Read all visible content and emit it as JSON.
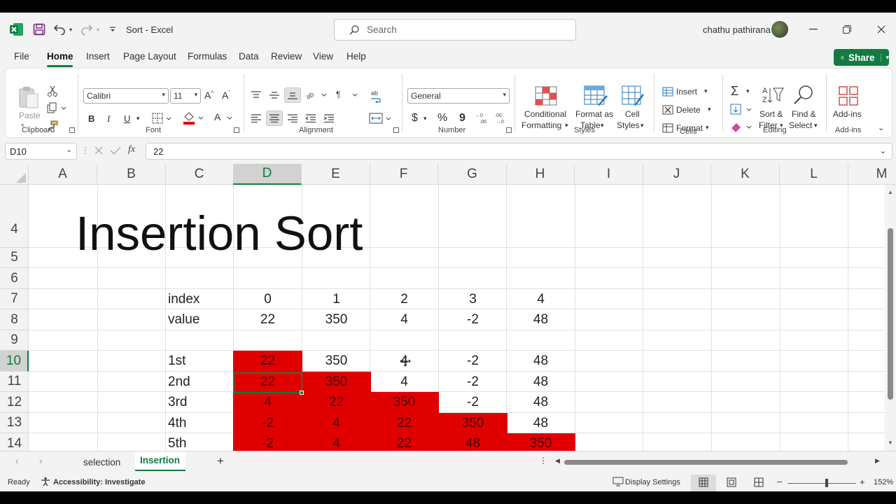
{
  "window": {
    "title": "Sort  -  Excel",
    "user_name": "chathu pathirana",
    "search_placeholder": "Search"
  },
  "menu": {
    "items": [
      "File",
      "Home",
      "Insert",
      "Page Layout",
      "Formulas",
      "Data",
      "Review",
      "View",
      "Help"
    ],
    "active": "Home",
    "share_label": "Share"
  },
  "ribbon": {
    "clipboard": {
      "paste": "Paste",
      "group": "Clipboard"
    },
    "font": {
      "family": "Calibri",
      "size": "11",
      "group": "Font",
      "bold": "B",
      "italic": "I",
      "underline": "U"
    },
    "alignment": {
      "group": "Alignment"
    },
    "number": {
      "format": "General",
      "group": "Number",
      "currency": "$",
      "percent": "%",
      "comma": "9"
    },
    "styles": {
      "conditional_1": "Conditional",
      "conditional_2": "Formatting",
      "format_table_1": "Format as",
      "format_table_2": "Table",
      "cell_styles_1": "Cell",
      "cell_styles_2": "Styles",
      "group": "Styles"
    },
    "cells": {
      "insert": "Insert",
      "delete": "Delete",
      "format": "Format",
      "group": "Cells"
    },
    "editing": {
      "sort_1": "Sort &",
      "sort_2": "Filter",
      "find_1": "Find &",
      "find_2": "Select",
      "group": "Editing"
    },
    "addins": {
      "label": "Add-ins",
      "group": "Add-ins"
    }
  },
  "formula_bar": {
    "name_box": "D10",
    "fx": "fx",
    "value": "22"
  },
  "sheet": {
    "columns": [
      "A",
      "B",
      "C",
      "D",
      "E",
      "F",
      "G",
      "H",
      "I",
      "J",
      "K",
      "L",
      "M"
    ],
    "selected_column": "D",
    "rows": [
      "4",
      "5",
      "6",
      "7",
      "8",
      "9",
      "10",
      "11",
      "12",
      "13",
      "14"
    ],
    "selected_row": "10",
    "title": "Insertion Sort",
    "table": [
      {
        "row": "7",
        "label": "index",
        "values": [
          "0",
          "1",
          "2",
          "3",
          "4"
        ],
        "red": []
      },
      {
        "row": "8",
        "label": "value",
        "values": [
          "22",
          "350",
          "4",
          "-2",
          "48"
        ],
        "red": []
      },
      {
        "row": "10",
        "label": "1st",
        "values": [
          "22",
          "350",
          "4",
          "-2",
          "48"
        ],
        "red": [
          0
        ]
      },
      {
        "row": "11",
        "label": "2nd",
        "values": [
          "22",
          "350",
          "4",
          "-2",
          "48"
        ],
        "red": [
          0,
          1
        ]
      },
      {
        "row": "12",
        "label": "3rd",
        "values": [
          "4",
          "22",
          "350",
          "-2",
          "48"
        ],
        "red": [
          0,
          1,
          2
        ]
      },
      {
        "row": "13",
        "label": "4th",
        "values": [
          "-2",
          "4",
          "22",
          "350",
          "48"
        ],
        "red": [
          0,
          1,
          2,
          3
        ]
      },
      {
        "row": "14",
        "label": "5th",
        "values": [
          "-2",
          "4",
          "22",
          "48",
          "350"
        ],
        "red": [
          0,
          1,
          2,
          3,
          4
        ]
      }
    ],
    "highlight_color": "#e00000"
  },
  "tabs": {
    "sheets": [
      "selection",
      "Insertion"
    ],
    "active": "Insertion",
    "add": "+"
  },
  "status": {
    "ready": "Ready",
    "accessibility": "Accessibility: Investigate",
    "display_settings": "Display Settings",
    "zoom": "152%"
  },
  "colors": {
    "accent": "#107c41"
  }
}
